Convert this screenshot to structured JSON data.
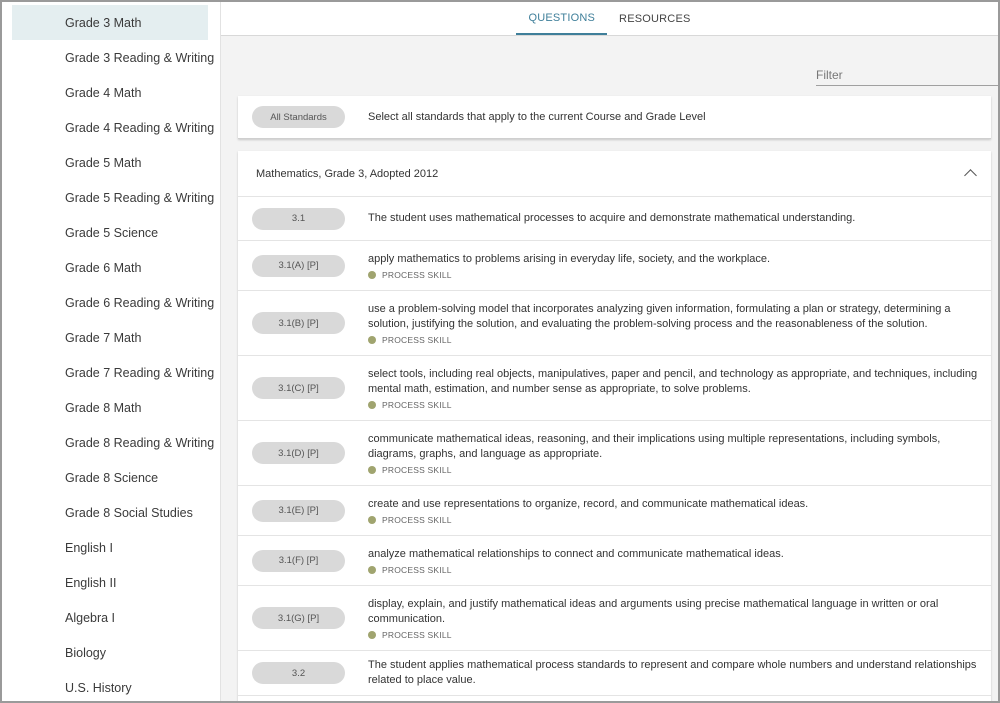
{
  "sidebar": {
    "items": [
      "Grade 3 Math",
      "Grade 3 Reading & Writing",
      "Grade 4 Math",
      "Grade 4 Reading & Writing",
      "Grade 5 Math",
      "Grade 5 Reading & Writing",
      "Grade 5 Science",
      "Grade 6 Math",
      "Grade 6 Reading & Writing",
      "Grade 7 Math",
      "Grade 7 Reading & Writing",
      "Grade 8 Math",
      "Grade 8 Reading & Writing",
      "Grade 8 Science",
      "Grade 8 Social Studies",
      "English I",
      "English II",
      "Algebra I",
      "Biology",
      "U.S. History"
    ],
    "active_index": 0
  },
  "tabs": {
    "questions": "QUESTIONS",
    "resources": "RESOURCES",
    "active": "questions"
  },
  "filter": {
    "placeholder": "Filter",
    "value": ""
  },
  "all_standards": {
    "label": "All Standards",
    "description": "Select all standards that apply to the current Course and Grade Level"
  },
  "standards_group": {
    "title": "Mathematics, Grade 3, Adopted 2012",
    "expanded": true,
    "rows": [
      {
        "code": "3.1",
        "text": "The student uses mathematical processes to acquire and demonstrate mathematical understanding.",
        "tag": ""
      },
      {
        "code": "3.1(A) [P]",
        "text": "apply mathematics to problems arising in everyday life, society, and the workplace.",
        "tag": "PROCESS SKILL"
      },
      {
        "code": "3.1(B) [P]",
        "text": "use a problem-solving model that incorporates analyzing given information, formulating a plan or strategy, determining a solution, justifying the solution, and evaluating the problem-solving process and the reasonableness of the solution.",
        "tag": "PROCESS SKILL"
      },
      {
        "code": "3.1(C) [P]",
        "text": "select tools, including real objects, manipulatives, paper and pencil, and technology as appropriate, and techniques, including mental math, estimation, and number sense as appropriate, to solve problems.",
        "tag": "PROCESS SKILL"
      },
      {
        "code": "3.1(D) [P]",
        "text": "communicate mathematical ideas, reasoning, and their implications using multiple representations, including symbols, diagrams, graphs, and language as appropriate.",
        "tag": "PROCESS SKILL"
      },
      {
        "code": "3.1(E) [P]",
        "text": "create and use representations to organize, record, and communicate mathematical ideas.",
        "tag": "PROCESS SKILL"
      },
      {
        "code": "3.1(F) [P]",
        "text": "analyze mathematical relationships to connect and communicate mathematical ideas.",
        "tag": "PROCESS SKILL"
      },
      {
        "code": "3.1(G) [P]",
        "text": "display, explain, and justify mathematical ideas and arguments using precise mathematical language in written or oral communication.",
        "tag": "PROCESS SKILL"
      },
      {
        "code": "3.2",
        "text": "The student applies mathematical process standards to represent and compare whole numbers and understand relationships related to place value.",
        "tag": ""
      }
    ]
  },
  "colors": {
    "accent": "#3f7f9a",
    "process_skill_dot": "#a0a46f",
    "active_sidebar_bg": "#e4eef0"
  }
}
